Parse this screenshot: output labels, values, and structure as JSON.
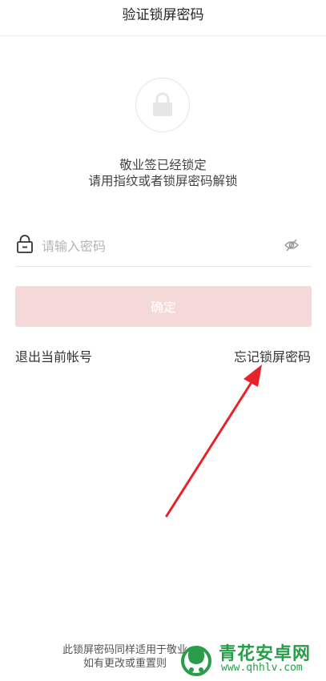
{
  "header": {
    "title": "验证锁屏密码"
  },
  "lock_screen": {
    "line1": "敬业签已经锁定",
    "line2": "请用指纹或者锁屏密码解锁"
  },
  "password": {
    "placeholder": "请输入密码",
    "value": ""
  },
  "confirm_label": "确定",
  "links": {
    "logout": "退出当前帐号",
    "forgot": "忘记锁屏密码"
  },
  "footer": {
    "note1": "此锁屏密码同样适用于敬业",
    "note2": "如有更改或重置则"
  },
  "watermark": {
    "name": "青花安卓网",
    "url": "www.qhhlv.com"
  },
  "colors": {
    "confirm_bg": "#f5d9d9",
    "arrow": "#e8232a",
    "watermark": "#2a9d4b"
  },
  "icons": {
    "lock_circle": "lock-icon",
    "password_lock": "lock-outline-icon",
    "visibility": "eye-off-icon"
  }
}
